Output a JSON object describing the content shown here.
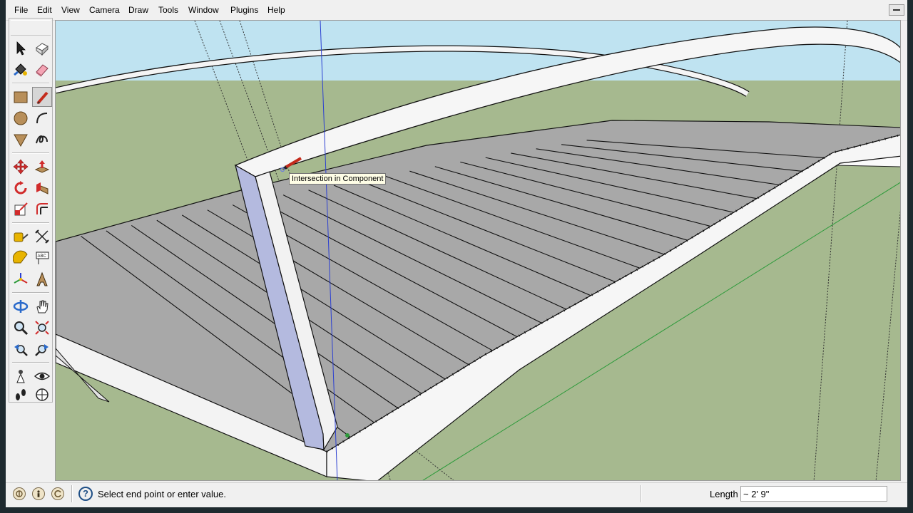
{
  "menu": [
    "File",
    "Edit",
    "View",
    "Camera",
    "Draw",
    "Tools",
    "Window",
    "Plugins",
    "Help"
  ],
  "toolbar": {
    "tools": [
      {
        "name": "select-tool-icon"
      },
      {
        "name": "make-component-tool-icon"
      },
      {
        "name": "paint-bucket-tool-icon"
      },
      {
        "name": "eraser-tool-icon"
      },
      {
        "name": "rectangle-tool-icon"
      },
      {
        "name": "line-tool-icon",
        "active": true
      },
      {
        "name": "circle-tool-icon"
      },
      {
        "name": "arc-tool-icon"
      },
      {
        "name": "polygon-tool-icon"
      },
      {
        "name": "freehand-tool-icon"
      },
      {
        "name": "move-tool-icon"
      },
      {
        "name": "push-pull-tool-icon"
      },
      {
        "name": "rotate-tool-icon"
      },
      {
        "name": "follow-me-tool-icon"
      },
      {
        "name": "scale-tool-icon"
      },
      {
        "name": "offset-tool-icon"
      },
      {
        "name": "tape-measure-tool-icon"
      },
      {
        "name": "dimension-tool-icon"
      },
      {
        "name": "protractor-tool-icon"
      },
      {
        "name": "text-tool-icon"
      },
      {
        "name": "axes-tool-icon"
      },
      {
        "name": "3d-text-tool-icon"
      },
      {
        "name": "orbit-tool-icon"
      },
      {
        "name": "pan-tool-icon"
      },
      {
        "name": "zoom-tool-icon"
      },
      {
        "name": "zoom-extents-tool-icon"
      },
      {
        "name": "previous-view-icon"
      },
      {
        "name": "next-view-icon"
      },
      {
        "name": "position-camera-tool-icon"
      },
      {
        "name": "look-around-tool-icon"
      },
      {
        "name": "walk-tool-icon"
      },
      {
        "name": "section-plane-tool-icon"
      }
    ]
  },
  "viewport": {
    "tooltip": "Intersection in Component",
    "colors": {
      "sky": "#bfe3f1",
      "ground": "#a6b98f",
      "deck": "#a8a8a8",
      "edge": "#000000",
      "axis_blue": "#2b3fd1",
      "axis_green": "#2c9a3a"
    }
  },
  "statusbar": {
    "icons": [
      "geo-location-icon",
      "credits-icon",
      "sign-in-icon"
    ],
    "help_icon_label": "?",
    "message": "Select end point or enter value.",
    "vcb_label": "Length",
    "vcb_value": "~ 2' 9\""
  }
}
